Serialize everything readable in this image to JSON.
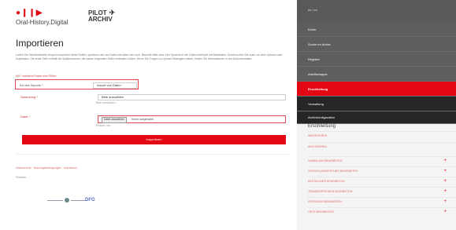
{
  "header": {
    "logo_marks": "●❙❙▶",
    "logo_text": "Oral-History.Digital",
    "pilot_line1": "PILOT",
    "pilot_icon": "✈",
    "pilot_line2": "ARCHIV"
  },
  "main": {
    "title": "Importieren",
    "description": "Laden Sie Tabelleninhalte bequem importiert diese Seiten, speichern als csv-Datei und laden sie hoch. Beachte bitte dass Ihre Sprache in der Datei verknüpft mit Metadaten. Durchsuchen Sie auch vor dem Upload nach Duplikaten. Die erste Zeile enthält die Spaltennamen, die darauf folgenden Zeilen enthalten Daten. Wenn Sie Fragen zu Upload Strategien haben, finden Sie Informationen in der Dokumentation.",
    "required_note": "Mit * markierte Felder sind Pflicht",
    "form": {
      "type_label": "Art des Imports *",
      "type_value": "Import von Daten",
      "collection_label": "Sammlung *",
      "collection_value": "Bitte auswählen",
      "collection_hint": "Bitte auswählen",
      "file_label": "Datei *",
      "file_button": "Datei auswählen",
      "file_none": "Keine ausgewählt",
      "file_hint": "Erlaubt: csv"
    },
    "import_button": "Importieren"
  },
  "footer": {
    "links": "Datenschutz · Nutzungsbedingungen · Impressum",
    "partner_label": "Förderer",
    "partner_dfg": "DFG"
  },
  "sidebar": {
    "lang": "de | en",
    "nav": [
      {
        "label": "Konto"
      },
      {
        "label": "Suche im Archiv"
      },
      {
        "label": "Register"
      },
      {
        "label": "Arbeitsmappe"
      },
      {
        "label": "Erschließung"
      },
      {
        "label": "Verwaltung"
      },
      {
        "label": "Archivkonfiguration"
      }
    ],
    "section_title": "Erschließung",
    "links": [
      {
        "label": "IMPORTIEREN",
        "plus": ""
      },
      {
        "label": "ARCHIVIEREN",
        "plus": ""
      },
      {
        "label": "SAMMLUNG BEARBEITEN",
        "plus": "+"
      },
      {
        "label": "VERSCHLAGWORTUNG BEARBEITEN",
        "plus": "+"
      },
      {
        "label": "DIGITALISATE BEARBEITEN",
        "plus": "+"
      },
      {
        "label": "TRANSKRIPTIONEN BEARBEITEN",
        "plus": "+"
      },
      {
        "label": "PERSONEN BEARBEITEN",
        "plus": "+"
      },
      {
        "label": "ORTE BEARBEITEN",
        "plus": "+"
      }
    ]
  },
  "colors": {
    "accent": "#e30613",
    "sidebar_bg": "#5e5e5e",
    "sidebar_dark": "#262626"
  }
}
